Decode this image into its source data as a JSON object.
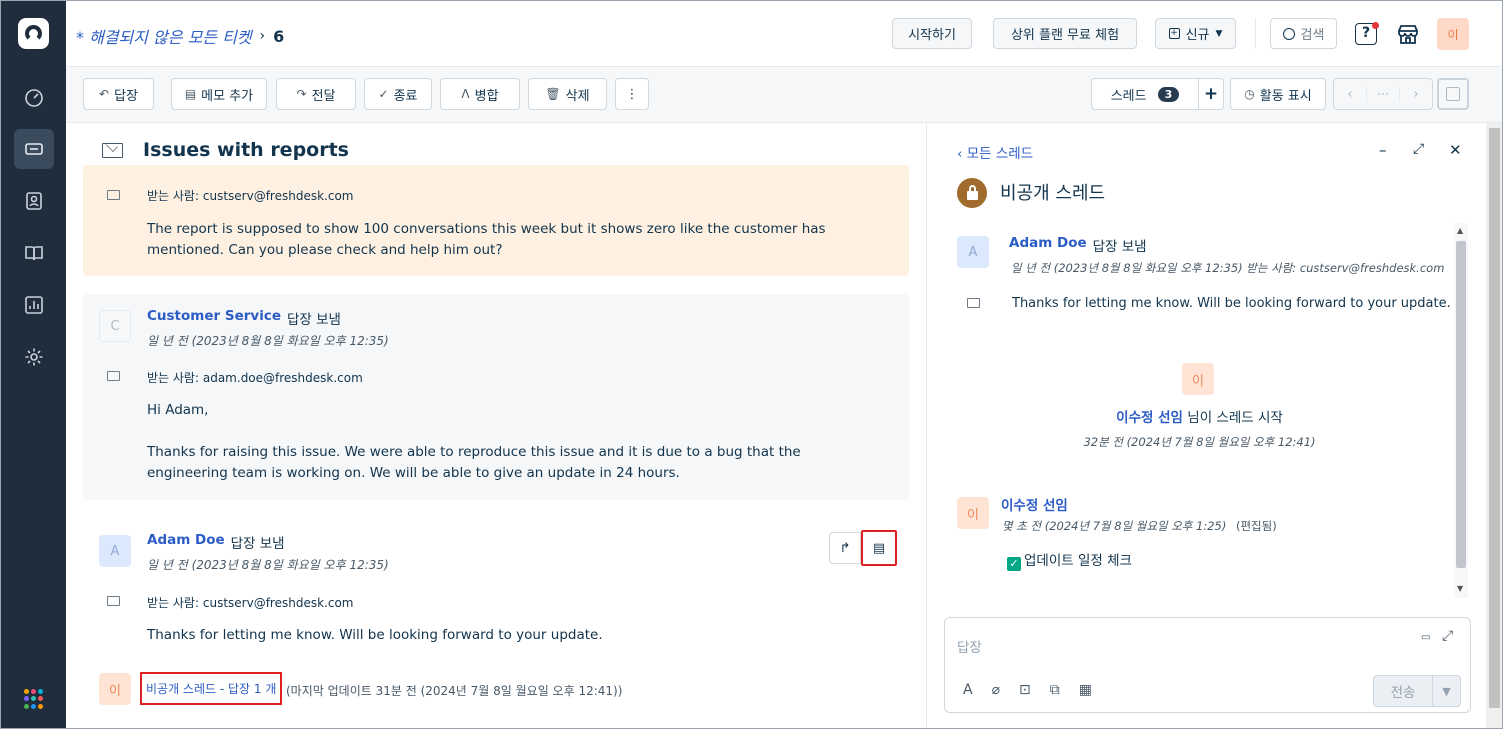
{
  "header": {
    "breadcrumb": "* 해결되지 않은 모든 티켓",
    "breadcrumb_sep": "›",
    "ticket_count": "6",
    "get_started": "시작하기",
    "free_trial": "상위 플랜 무료 체험",
    "new_button": "신규",
    "search": "검색",
    "avatar_initial": "이"
  },
  "toolbar": {
    "reply": "답장",
    "add_note": "메모 추가",
    "forward": "전달",
    "close": "종료",
    "merge": "병합",
    "delete": "삭제",
    "threads_label": "스레드",
    "threads_count": "3",
    "activity": "활동 표시"
  },
  "ticket": {
    "subject": "Issues with reports",
    "to_label": "받는 사람:",
    "first_message": {
      "to": "custserv@freshdesk.com",
      "body": "The report is supposed to show 100 conversations this week but it shows zero like the customer has mentioned. Can you please check and help him out?"
    },
    "reply_cs": {
      "initial": "C",
      "name": "Customer Service",
      "action": "답장 보냄",
      "time": "일 년 전 (2023년 8월 8일 화요일 오후 12:35)",
      "to": "adam.doe@freshdesk.com",
      "greeting": "Hi Adam,",
      "body": "Thanks for raising this issue. We were able to reproduce this issue and it is due to a bug that the engineering team is working on. We will be able to give an update in 24 hours."
    },
    "reply_adam": {
      "initial": "A",
      "name": "Adam Doe",
      "action": "답장 보냄",
      "time": "일 년 전 (2023년 8월 8일 화요일 오후 12:35)",
      "to": "custserv@freshdesk.com",
      "body": "Thanks for letting me know. Will be looking forward to your update."
    },
    "thread_avatar": "이",
    "thread_link": "비공개 스레드 - 답장 1 개",
    "thread_meta": "(마지막 업데이트 31분 전 (2024년 7월 8일 월요일 오후 12:41))"
  },
  "side": {
    "back": "모든 스레드",
    "title": "비공개 스레드",
    "msg": {
      "initial": "A",
      "name": "Adam Doe",
      "action": "답장 보냄",
      "time": "일 년 전 (2023년 8월 8일 화요일 오후 12:35)",
      "to_label": "받는 사람:",
      "to": "custserv@freshdesk.com",
      "body": "Thanks for letting me know. Will be looking forward to your update."
    },
    "started": {
      "initial": "이",
      "name": "이수정 선임",
      "suffix": "님이 스레드 시작",
      "time": "32분 전 (2024년 7월 8일 월요일 오후 12:41)"
    },
    "note": {
      "initial": "이",
      "name": "이수정 선임",
      "time": "몇 초 전 (2024년 7월 8일 월요일 오후 1:25)",
      "edited": "(편집됨)",
      "body": "업데이트 일정 체크"
    },
    "composer_placeholder": "답장",
    "send": "전송"
  }
}
